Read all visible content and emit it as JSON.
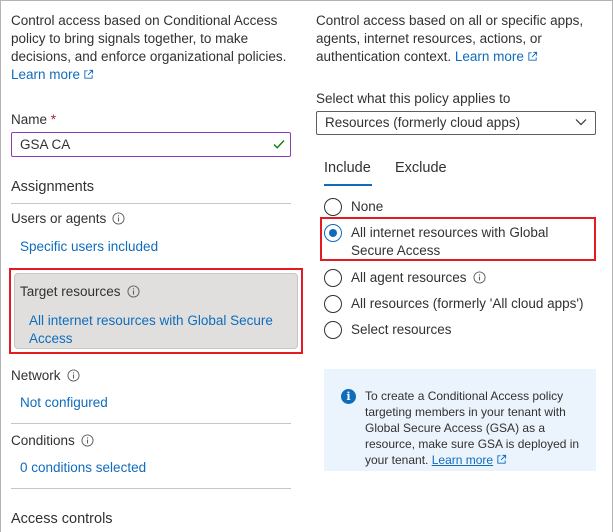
{
  "left": {
    "description": "Control access based on Conditional Access policy to bring signals together, to make decisions, and enforce organizational policies.",
    "learn_more": "Learn more",
    "name_label": "Name",
    "required_mark": "*",
    "name_value": "GSA CA",
    "assignments_heading": "Assignments",
    "users_label": "Users or agents",
    "users_value": "Specific users included",
    "target_label": "Target resources",
    "target_value": "All internet resources with Global Secure Access",
    "network_label": "Network",
    "network_value": "Not configured",
    "conditions_label": "Conditions",
    "conditions_value": "0 conditions selected",
    "access_controls_heading": "Access controls"
  },
  "right": {
    "description": "Control access based on all or specific apps, agents, internet resources, actions, or authentication context.",
    "learn_more": "Learn more",
    "applies_label": "Select what this policy applies to",
    "applies_value": "Resources (formerly cloud apps)",
    "tabs": [
      "Include",
      "Exclude"
    ],
    "options": [
      "None",
      "All internet resources with Global Secure Access",
      "All agent resources",
      "All resources (formerly 'All cloud apps')",
      "Select resources"
    ],
    "selected_option": "All internet resources with Global Secure Access",
    "info_text": "To create a Conditional Access policy targeting members in your tenant with Global Secure Access (GSA) as a resource, make sure GSA is deployed in your tenant.",
    "info_learn_more": "Learn more"
  },
  "colors": {
    "link": "#0f6cbd",
    "highlight_border": "#e31b23",
    "info_background": "#ebf3fc",
    "selected_card": "#e1dfdd"
  },
  "icons": [
    "external-link-icon",
    "checkmark-icon",
    "info-icon",
    "chevron-down-icon",
    "info-filled-icon"
  ]
}
